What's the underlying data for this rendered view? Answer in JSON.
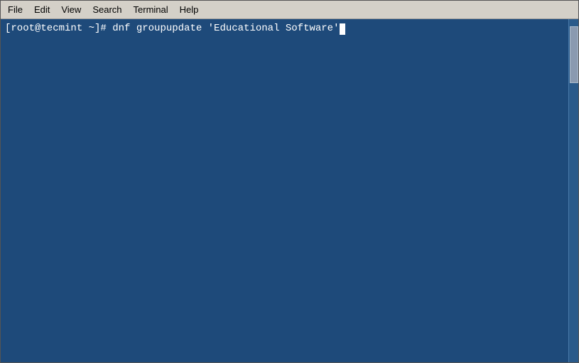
{
  "menubar": {
    "items": [
      {
        "label": "File"
      },
      {
        "label": "Edit"
      },
      {
        "label": "View"
      },
      {
        "label": "Search"
      },
      {
        "label": "Terminal"
      },
      {
        "label": "Help"
      }
    ]
  },
  "terminal": {
    "background_color": "#1e4a7a",
    "prompt": "[root@tecmint ~]#",
    "command": " dnf groupupdate 'Educational Software'"
  }
}
